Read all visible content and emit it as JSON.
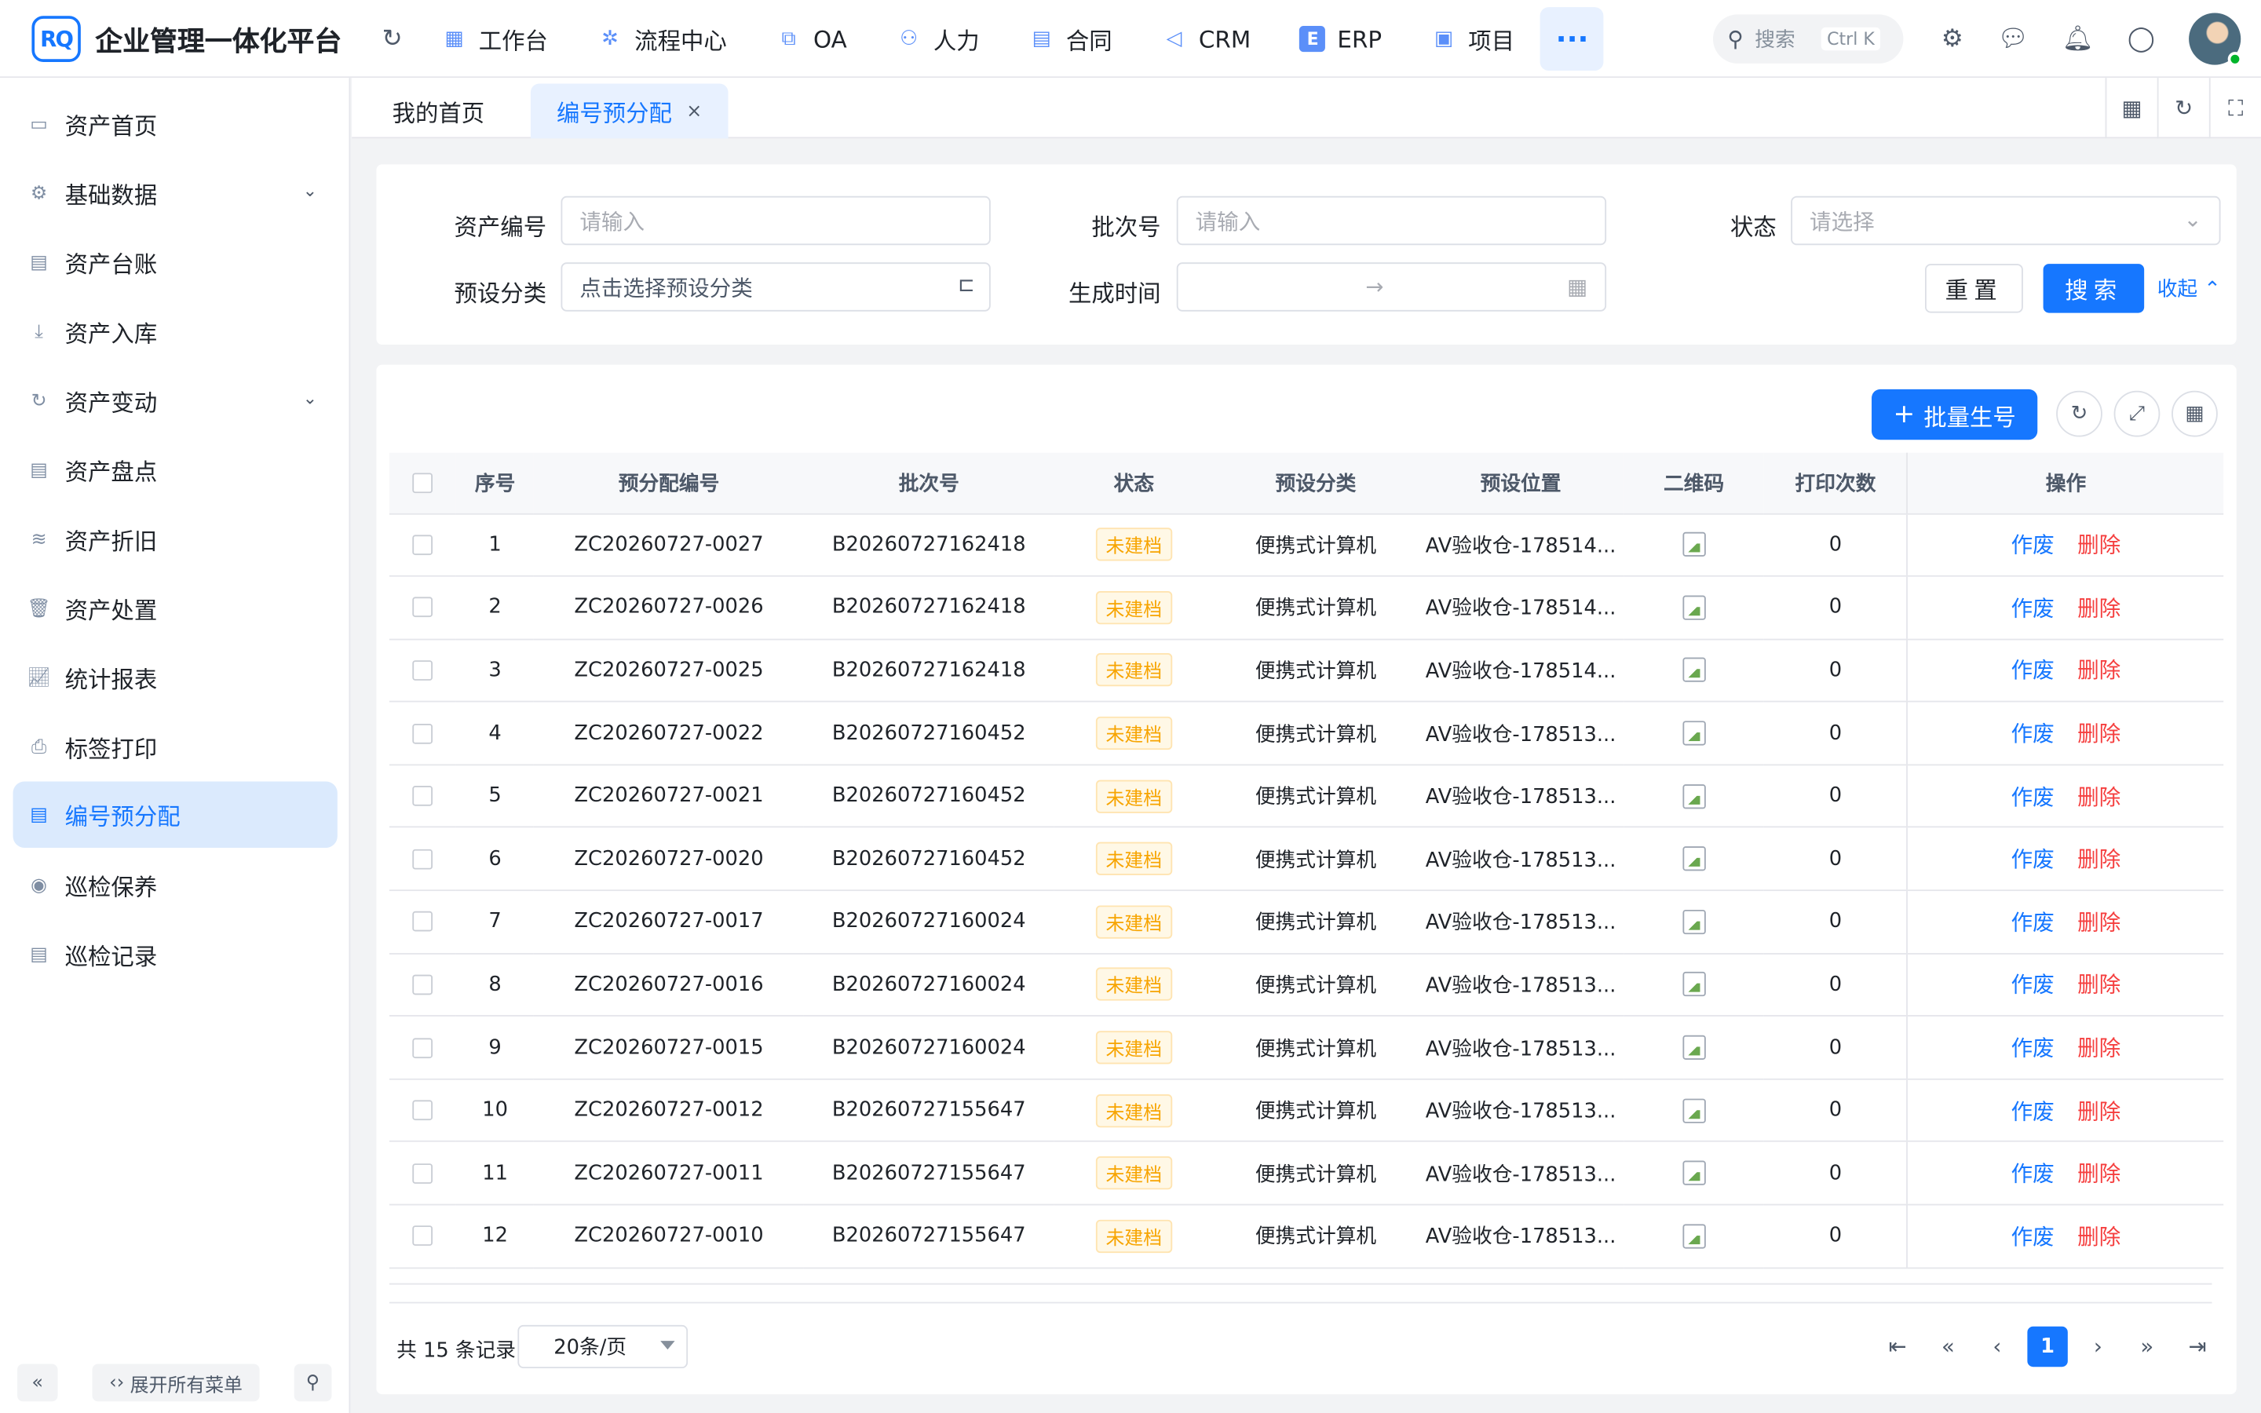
{
  "app": {
    "logo_text": "RQ",
    "title": "企业管理一体化平台"
  },
  "topnav": {
    "items": [
      {
        "label": "工作台",
        "icon": "dashboard-icon"
      },
      {
        "label": "流程中心",
        "icon": "workflow-icon"
      },
      {
        "label": "OA",
        "icon": "oa-icon"
      },
      {
        "label": "人力",
        "icon": "people-icon"
      },
      {
        "label": "合同",
        "icon": "contract-icon"
      },
      {
        "label": "CRM",
        "icon": "crm-icon"
      },
      {
        "label": "ERP",
        "icon": "erp-icon"
      },
      {
        "label": "项目",
        "icon": "project-icon"
      }
    ],
    "more": "···",
    "search_placeholder": "搜索",
    "search_shortcut": "Ctrl K"
  },
  "sidebar": {
    "items": [
      {
        "label": "资产首页",
        "expandable": false,
        "active": false
      },
      {
        "label": "基础数据",
        "expandable": true,
        "active": false
      },
      {
        "label": "资产台账",
        "expandable": false,
        "active": false
      },
      {
        "label": "资产入库",
        "expandable": false,
        "active": false
      },
      {
        "label": "资产变动",
        "expandable": true,
        "active": false
      },
      {
        "label": "资产盘点",
        "expandable": false,
        "active": false
      },
      {
        "label": "资产折旧",
        "expandable": false,
        "active": false
      },
      {
        "label": "资产处置",
        "expandable": false,
        "active": false
      },
      {
        "label": "统计报表",
        "expandable": false,
        "active": false
      },
      {
        "label": "标签打印",
        "expandable": false,
        "active": false
      },
      {
        "label": "编号预分配",
        "expandable": false,
        "active": true
      },
      {
        "label": "巡检保养",
        "expandable": false,
        "active": false
      },
      {
        "label": "巡检记录",
        "expandable": false,
        "active": false
      }
    ],
    "expand_all_label": "展开所有菜单"
  },
  "tabs": [
    {
      "label": "我的首页",
      "active": false
    },
    {
      "label": "编号预分配",
      "active": true,
      "close": "×"
    }
  ],
  "filters": {
    "asset_no": {
      "label": "资产编号",
      "placeholder": "请输入"
    },
    "batch_no": {
      "label": "批次号",
      "placeholder": "请输入"
    },
    "status": {
      "label": "状态",
      "placeholder": "请选择"
    },
    "preset_category": {
      "label": "预设分类",
      "placeholder": "点击选择预设分类"
    },
    "gen_time": {
      "label": "生成时间",
      "arrow": "→"
    },
    "reset_label": "重置",
    "search_label": "搜索",
    "collapse_label": "收起"
  },
  "toolbar": {
    "batch_label": "批量生号",
    "batch_plus": "+"
  },
  "table": {
    "columns": [
      "序号",
      "预分配编号",
      "批次号",
      "状态",
      "预设分类",
      "预设位置",
      "二维码",
      "打印次数",
      "操作"
    ],
    "rows": [
      {
        "seq": "1",
        "code": "ZC20260727-0027",
        "batch": "B20260727162418",
        "status": "未建档",
        "category": "便携式计算机",
        "location": "AV验收仓-178514...",
        "prints": "0"
      },
      {
        "seq": "2",
        "code": "ZC20260727-0026",
        "batch": "B20260727162418",
        "status": "未建档",
        "category": "便携式计算机",
        "location": "AV验收仓-178514...",
        "prints": "0"
      },
      {
        "seq": "3",
        "code": "ZC20260727-0025",
        "batch": "B20260727162418",
        "status": "未建档",
        "category": "便携式计算机",
        "location": "AV验收仓-178514...",
        "prints": "0"
      },
      {
        "seq": "4",
        "code": "ZC20260727-0022",
        "batch": "B20260727160452",
        "status": "未建档",
        "category": "便携式计算机",
        "location": "AV验收仓-178513...",
        "prints": "0"
      },
      {
        "seq": "5",
        "code": "ZC20260727-0021",
        "batch": "B20260727160452",
        "status": "未建档",
        "category": "便携式计算机",
        "location": "AV验收仓-178513...",
        "prints": "0"
      },
      {
        "seq": "6",
        "code": "ZC20260727-0020",
        "batch": "B20260727160452",
        "status": "未建档",
        "category": "便携式计算机",
        "location": "AV验收仓-178513...",
        "prints": "0"
      },
      {
        "seq": "7",
        "code": "ZC20260727-0017",
        "batch": "B20260727160024",
        "status": "未建档",
        "category": "便携式计算机",
        "location": "AV验收仓-178513...",
        "prints": "0"
      },
      {
        "seq": "8",
        "code": "ZC20260727-0016",
        "batch": "B20260727160024",
        "status": "未建档",
        "category": "便携式计算机",
        "location": "AV验收仓-178513...",
        "prints": "0"
      },
      {
        "seq": "9",
        "code": "ZC20260727-0015",
        "batch": "B20260727160024",
        "status": "未建档",
        "category": "便携式计算机",
        "location": "AV验收仓-178513...",
        "prints": "0"
      },
      {
        "seq": "10",
        "code": "ZC20260727-0012",
        "batch": "B20260727155647",
        "status": "未建档",
        "category": "便携式计算机",
        "location": "AV验收仓-178513...",
        "prints": "0"
      },
      {
        "seq": "11",
        "code": "ZC20260727-0011",
        "batch": "B20260727155647",
        "status": "未建档",
        "category": "便携式计算机",
        "location": "AV验收仓-178513...",
        "prints": "0"
      },
      {
        "seq": "12",
        "code": "ZC20260727-0010",
        "batch": "B20260727155647",
        "status": "未建档",
        "category": "便携式计算机",
        "location": "AV验收仓-178513...",
        "prints": "0"
      }
    ],
    "action_void": "作废",
    "action_delete": "删除"
  },
  "pagination": {
    "total_text": "共 15 条记录",
    "page_size": "20条/页",
    "current_page": "1"
  },
  "colors": {
    "primary": "#1677ff",
    "danger": "#f53f3f",
    "warning": "#f7a400"
  }
}
